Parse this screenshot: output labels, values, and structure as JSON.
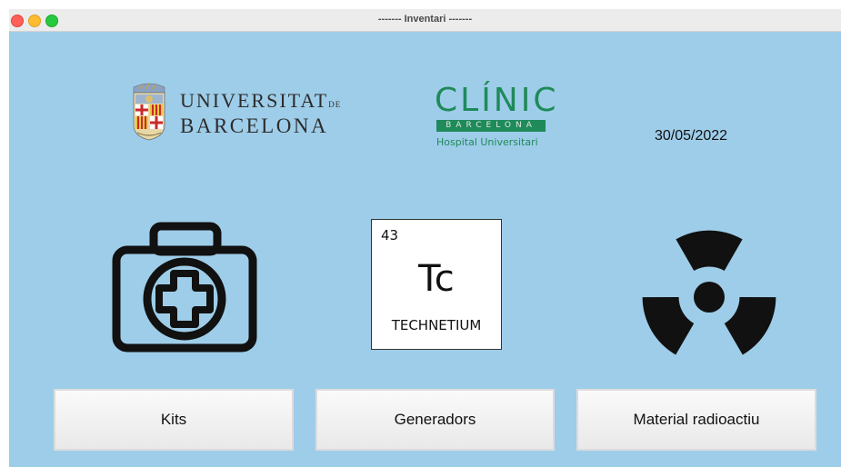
{
  "window": {
    "title": "------- Inventari -------"
  },
  "logos": {
    "university": {
      "line1": "UNIVERSITAT",
      "line1_suffix": "DE",
      "line2": "BARCELONA",
      "crest_icon": "university-crest-icon"
    },
    "hospital": {
      "name": "CLÍNIC",
      "city": "BARCELONA",
      "subtitle": "Hospital Universitari"
    }
  },
  "date": "30/05/2022",
  "icons": {
    "kits": "first-aid-kit-icon",
    "generators": "technetium-element-icon",
    "radioactive": "radiation-icon"
  },
  "element": {
    "number": "43",
    "symbol": "Tc",
    "name": "TECHNETIUM"
  },
  "buttons": {
    "kits": "Kits",
    "generators": "Generadors",
    "material": "Material radioactiu"
  },
  "colors": {
    "background": "#9ecde9",
    "clinic_green": "#1f8a5a"
  }
}
